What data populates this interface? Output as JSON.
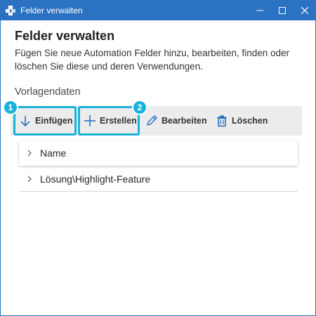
{
  "window": {
    "title": "Felder verwalten"
  },
  "header": {
    "title": "Felder verwalten",
    "description": "Fügen Sie neue Automation Felder hinzu, bearbeiten, finden oder löschen Sie diese und deren Verwendungen."
  },
  "section": {
    "label": "Vorlagendaten"
  },
  "toolbar": {
    "insert_label": "Einfügen",
    "create_label": "Erstellen",
    "edit_label": "Bearbeiten",
    "delete_label": "Löschen"
  },
  "callouts": [
    "1",
    "2"
  ],
  "tree": {
    "items": [
      {
        "label": "Name"
      },
      {
        "label": "Lösung\\Highlight-Feature"
      }
    ]
  },
  "colors": {
    "titlebar": "#2b73c2",
    "highlight": "#1ab2d9",
    "icon_blue": "#2b73c2"
  }
}
